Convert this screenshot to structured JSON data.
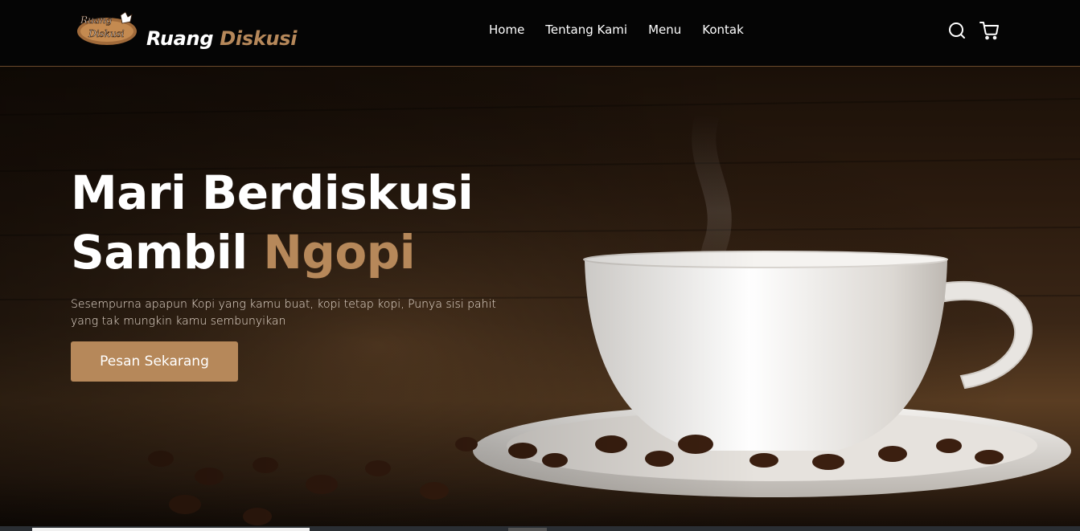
{
  "brand": {
    "name_main": "Ruang",
    "name_accent": "Diskusi",
    "logo_alt": "Ruang Diskusi logo"
  },
  "nav": {
    "links": [
      "Home",
      "Tentang Kami",
      "Menu",
      "Kontak"
    ]
  },
  "icons": {
    "search": "search-icon",
    "cart": "cart-icon"
  },
  "hero": {
    "title_line1": "Mari Berdiskusi",
    "title_line2_main": "Sambil",
    "title_line2_accent": "Ngopi",
    "description": "Sesempurna apapun Kopi yang kamu buat, kopi tetap kopi, Punya sisi pahit yang tak mungkin kamu sembunyikan",
    "cta_label": "Pesan Sekarang"
  },
  "colors": {
    "accent": "#b6885a",
    "background": "#050505"
  }
}
